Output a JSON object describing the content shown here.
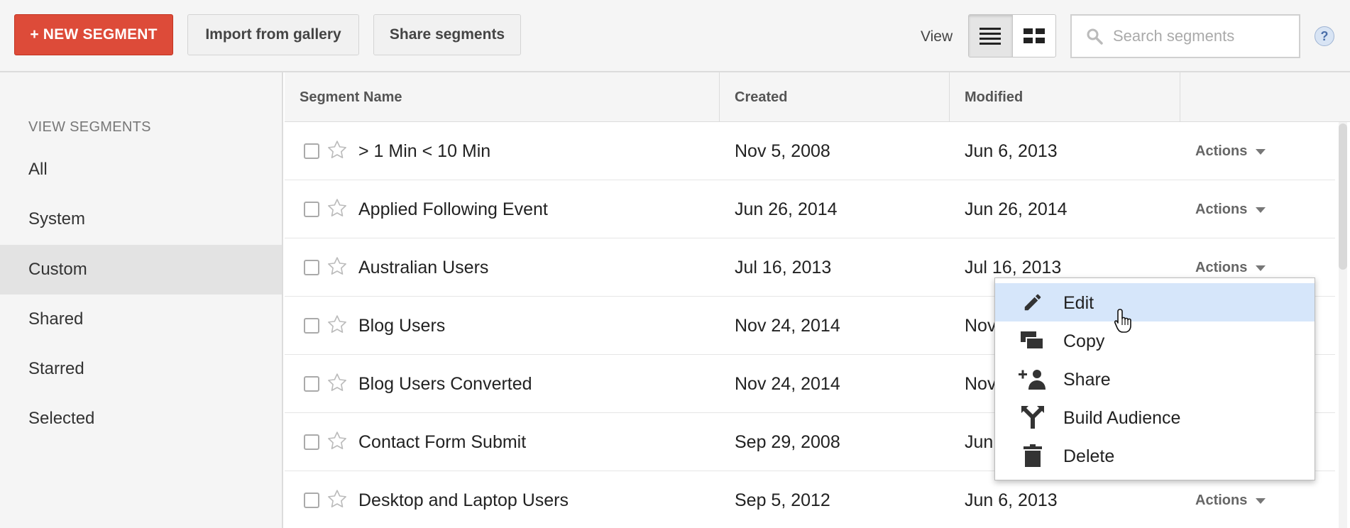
{
  "toolbar": {
    "new_segment_label": "+ NEW SEGMENT",
    "import_label": "Import from gallery",
    "share_label": "Share segments",
    "view_label": "View",
    "view_modes": [
      {
        "icon": "list-view-icon",
        "active": true
      },
      {
        "icon": "grid-view-icon",
        "active": false
      }
    ],
    "search_placeholder": "Search segments",
    "search_value": "",
    "help_label": "?"
  },
  "sidebar": {
    "heading": "VIEW SEGMENTS",
    "items": [
      {
        "label": "All",
        "selected": false
      },
      {
        "label": "System",
        "selected": false
      },
      {
        "label": "Custom",
        "selected": true
      },
      {
        "label": "Shared",
        "selected": false
      },
      {
        "label": "Starred",
        "selected": false
      },
      {
        "label": "Selected",
        "selected": false
      }
    ]
  },
  "table": {
    "columns": [
      "Segment Name",
      "Created",
      "Modified",
      ""
    ],
    "actions_label": "Actions",
    "rows": [
      {
        "name": "> 1 Min < 10 Min",
        "created": "Nov 5, 2008",
        "modified": "Jun 6, 2013",
        "show_actions": true
      },
      {
        "name": "Applied Following Event",
        "created": "Jun 26, 2014",
        "modified": "Jun 26, 2014",
        "show_actions": true
      },
      {
        "name": "Australian Users",
        "created": "Jul 16, 2013",
        "modified": "Jul 16, 2013",
        "show_actions": true
      },
      {
        "name": "Blog Users",
        "created": "Nov 24, 2014",
        "modified": "Nov",
        "show_actions": false
      },
      {
        "name": "Blog Users Converted",
        "created": "Nov 24, 2014",
        "modified": "Nov",
        "show_actions": false
      },
      {
        "name": "Contact Form Submit",
        "created": "Sep 29, 2008",
        "modified": "Jun",
        "show_actions": false
      },
      {
        "name": "Desktop and Laptop Users",
        "created": "Sep 5, 2012",
        "modified": "Jun 6, 2013",
        "show_actions": true
      }
    ]
  },
  "actions_menu": {
    "items": [
      {
        "label": "Edit",
        "icon": "pencil-icon",
        "hover": true
      },
      {
        "label": "Copy",
        "icon": "copy-icon",
        "hover": false
      },
      {
        "label": "Share",
        "icon": "add-person-icon",
        "hover": false
      },
      {
        "label": "Build Audience",
        "icon": "merge-arrow-icon",
        "hover": false
      },
      {
        "label": "Delete",
        "icon": "trash-icon",
        "hover": false
      }
    ]
  },
  "colors": {
    "primary_red": "#dd4b39",
    "menu_hover": "#d6e6fa",
    "sidebar_selected": "#e3e3e3"
  }
}
